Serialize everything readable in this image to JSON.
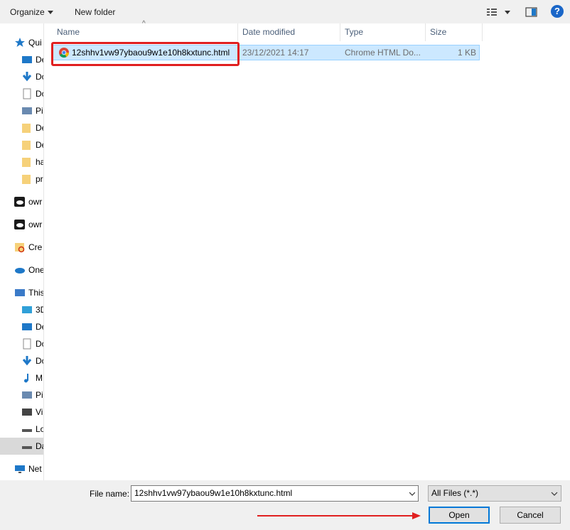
{
  "toolbar": {
    "organize": "Organize",
    "new_folder": "New folder",
    "help": "?"
  },
  "nav": {
    "items": [
      {
        "label": "Qui",
        "icon": "star-icon"
      },
      {
        "label": "De",
        "icon": "desktop-icon"
      },
      {
        "label": "Do",
        "icon": "download-icon"
      },
      {
        "label": "Do",
        "icon": "document-icon"
      },
      {
        "label": "Pi",
        "icon": "pictures-icon"
      },
      {
        "label": "De",
        "icon": "folder-icon"
      },
      {
        "label": "De",
        "icon": "folder-icon"
      },
      {
        "label": "ha",
        "icon": "folder-icon"
      },
      {
        "label": "pr",
        "icon": "folder-icon"
      },
      {
        "label": "owr",
        "icon": "cloud-icon"
      },
      {
        "label": "owr",
        "icon": "cloud-icon"
      },
      {
        "label": "Cre",
        "icon": "creative-cloud-icon"
      },
      {
        "label": "One",
        "icon": "onedrive-icon"
      },
      {
        "label": "This",
        "icon": "computer-icon"
      },
      {
        "label": "3D",
        "icon": "cube-icon"
      },
      {
        "label": "De",
        "icon": "desktop-icon"
      },
      {
        "label": "Do",
        "icon": "document-icon"
      },
      {
        "label": "Do",
        "icon": "download-icon"
      },
      {
        "label": "M",
        "icon": "music-icon"
      },
      {
        "label": "Pi",
        "icon": "pictures-icon"
      },
      {
        "label": "Vi",
        "icon": "video-icon"
      },
      {
        "label": "Lo",
        "icon": "drive-icon"
      },
      {
        "label": "Da",
        "icon": "drive-icon"
      },
      {
        "label": "Net",
        "icon": "network-icon"
      }
    ]
  },
  "columns": {
    "name": "Name",
    "date": "Date modified",
    "type": "Type",
    "size": "Size"
  },
  "file": {
    "name": "12shhv1vw97ybaou9w1e10h8kxtunc.html",
    "date": "23/12/2021 14:17",
    "type": "Chrome HTML Do...",
    "size": "1 KB"
  },
  "bottom": {
    "file_name_label": "File name:",
    "file_name_value": "12shhv1vw97ybaou9w1e10h8kxtunc.html",
    "file_type": "All Files (*.*)",
    "open": "Open",
    "cancel": "Cancel"
  },
  "colors": {
    "selection": "#cce8ff",
    "highlight": "#e02020",
    "accent": "#0078d7"
  }
}
